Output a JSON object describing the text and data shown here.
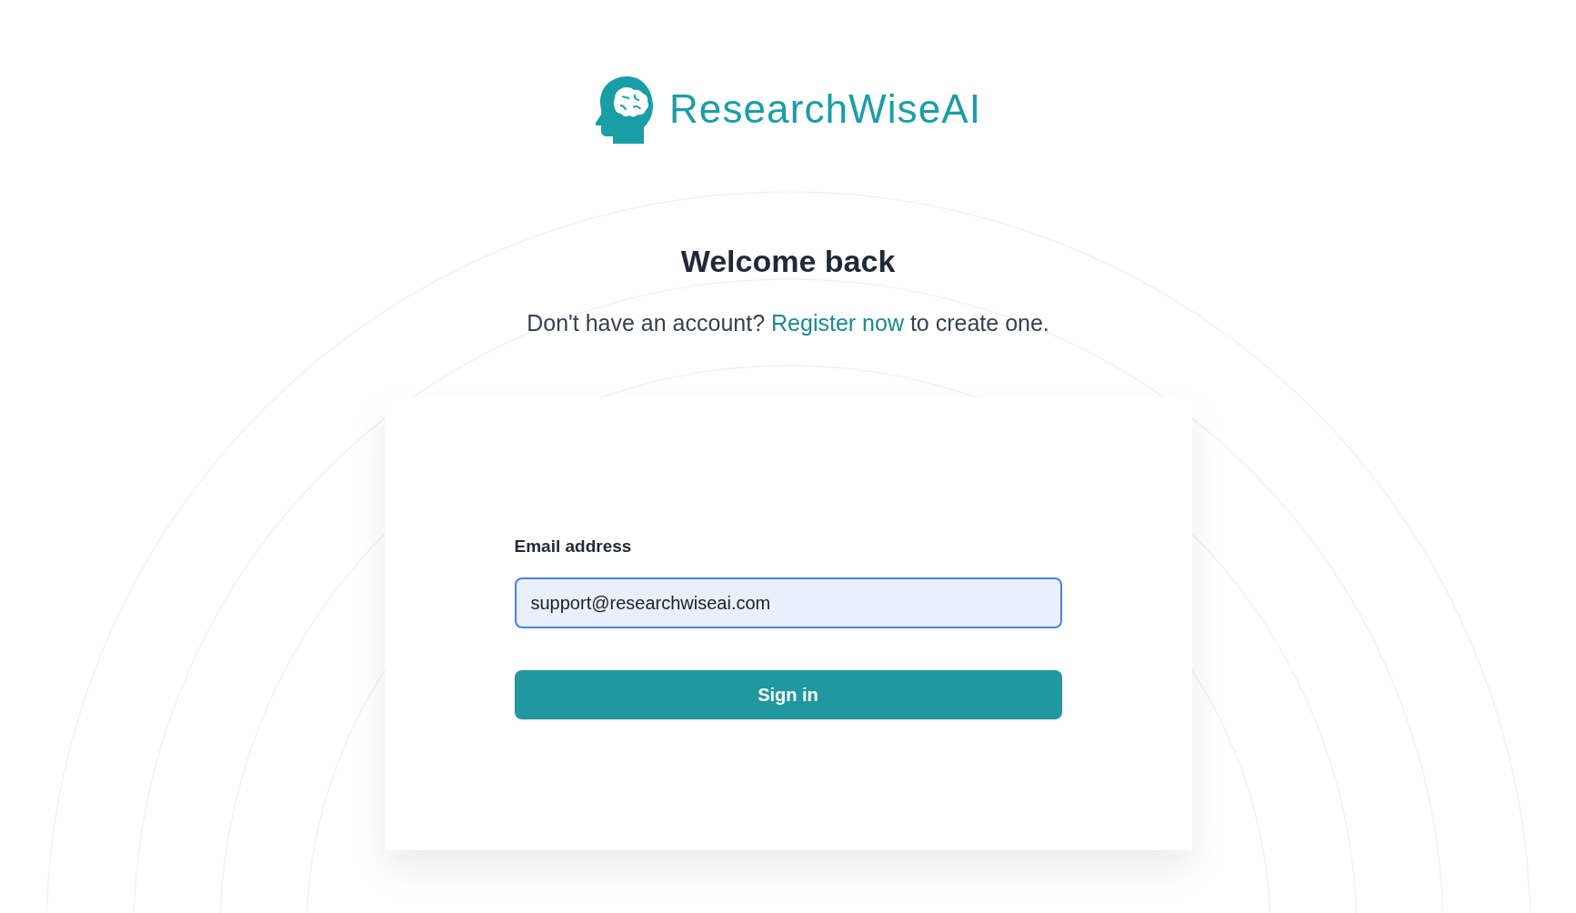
{
  "logo": {
    "text": "ResearchWiseAI"
  },
  "heading": "Welcome back",
  "subtitle": {
    "before": "Don't have an account?",
    "link": "Register now",
    "after": "to create one."
  },
  "form": {
    "email": {
      "label": "Email address",
      "value": "support@researchwiseai.com"
    },
    "submit": {
      "label": "Sign in"
    }
  }
}
